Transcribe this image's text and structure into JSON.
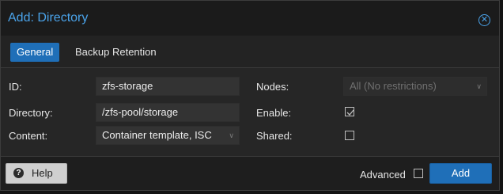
{
  "dialog": {
    "title": "Add: Directory",
    "close_icon": "close-circle-icon"
  },
  "tabs": [
    {
      "label": "General",
      "active": true
    },
    {
      "label": "Backup Retention",
      "active": false
    }
  ],
  "form": {
    "id": {
      "label": "ID:",
      "value": "zfs-storage"
    },
    "directory": {
      "label": "Directory:",
      "value": "/zfs-pool/storage"
    },
    "content": {
      "label": "Content:",
      "value": "Container template, ISC"
    },
    "nodes": {
      "label": "Nodes:",
      "value": "All (No restrictions)"
    },
    "enable": {
      "label": "Enable:",
      "checked": true
    },
    "shared": {
      "label": "Shared:",
      "checked": false
    }
  },
  "footer": {
    "help_label": "Help",
    "advanced_label": "Advanced",
    "advanced_checked": false,
    "add_label": "Add"
  },
  "colors": {
    "accent": "#1f6fb8",
    "title": "#4aa3ea"
  }
}
